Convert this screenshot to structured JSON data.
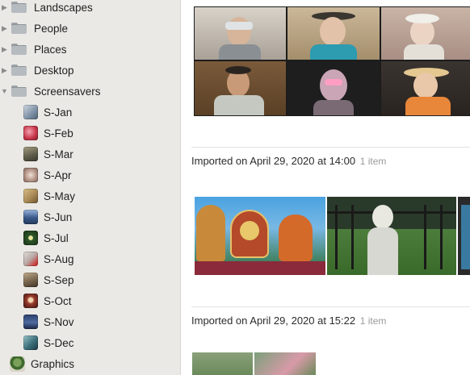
{
  "sidebar": {
    "folders": [
      {
        "label": "Landscapes",
        "expanded": false
      },
      {
        "label": "People",
        "expanded": false
      },
      {
        "label": "Places",
        "expanded": false
      },
      {
        "label": "Desktop",
        "expanded": false
      },
      {
        "label": "Screensavers",
        "expanded": true
      }
    ],
    "albums": [
      {
        "label": "S-Jan",
        "color": "#8ea0b5"
      },
      {
        "label": "S-Feb",
        "color": "#c8364a"
      },
      {
        "label": "S-Mar",
        "color": "#6e6a55"
      },
      {
        "label": "S-Apr",
        "color": "#b99a8c"
      },
      {
        "label": "S-May",
        "color": "#a98a55"
      },
      {
        "label": "S-Jun",
        "color": "#3a5a8a"
      },
      {
        "label": "S-Jul",
        "color": "#2f5a2a"
      },
      {
        "label": "S-Aug",
        "color": "#b8aaa6"
      },
      {
        "label": "S-Sep",
        "color": "#7d6a52"
      },
      {
        "label": "S-Oct",
        "color": "#9a3a2c"
      },
      {
        "label": "S-Nov",
        "color": "#2d3f6a"
      },
      {
        "label": "S-Dec",
        "color": "#3c6e7a"
      }
    ],
    "graphics_label": "Graphics"
  },
  "main": {
    "groups": [
      {
        "imported_prefix": "Imported on",
        "date": "April 29, 2020 at 14:00",
        "count": "1 item"
      },
      {
        "imported_prefix": "Imported on",
        "date": "April 29, 2020 at 15:22",
        "count": "1 item"
      }
    ]
  }
}
